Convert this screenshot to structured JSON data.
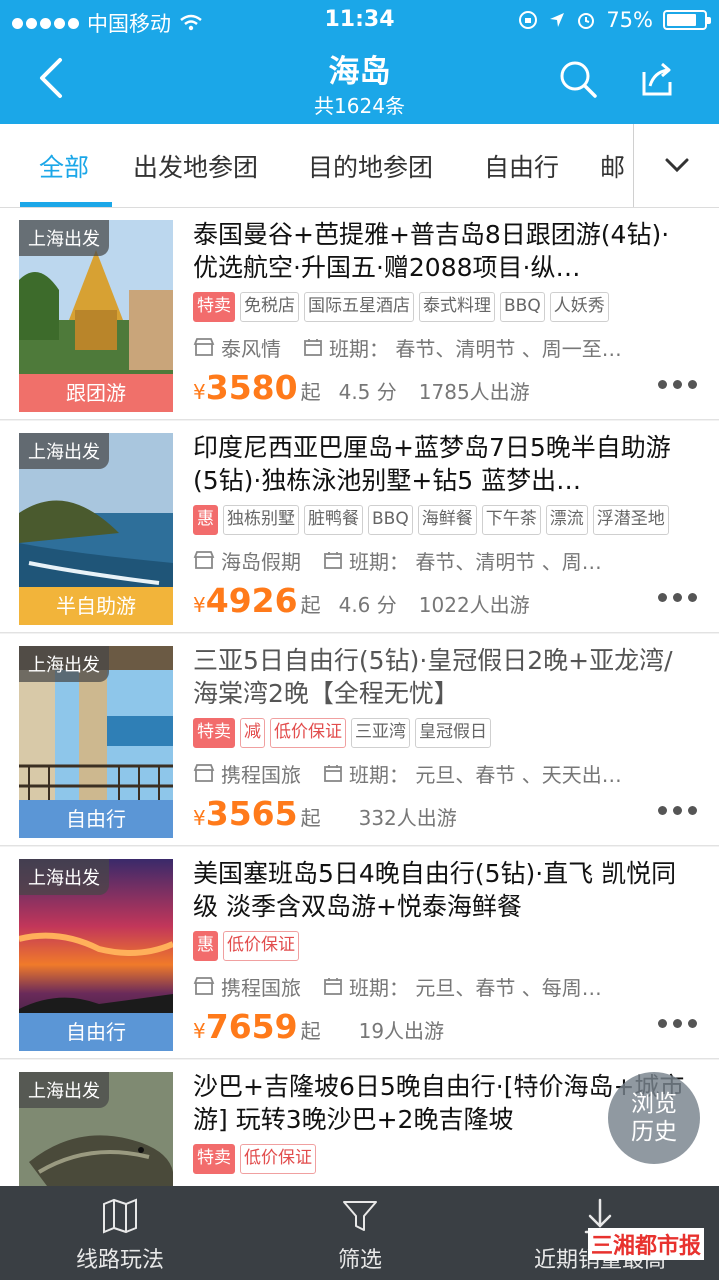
{
  "status_bar": {
    "carrier": "中国移动",
    "time": "11:34",
    "battery": "75%"
  },
  "header": {
    "title": "海岛",
    "subtitle": "共1624条"
  },
  "tabs": [
    {
      "label": "全部",
      "active": true
    },
    {
      "label": "出发地参团",
      "active": false
    },
    {
      "label": "目的地参团",
      "active": false
    },
    {
      "label": "自由行",
      "active": false
    },
    {
      "label": "邮",
      "active": false
    }
  ],
  "items": [
    {
      "depart": "上海出发",
      "type_label": "跟团游",
      "type_color": "#f0706a",
      "title": "泰国曼谷+芭提雅+普吉岛8日跟团游(4钻)·优选航空·升国五·赠2088项目·纵…",
      "tags": [
        {
          "text": "特卖",
          "style": "hot"
        },
        {
          "text": "免税店",
          "style": ""
        },
        {
          "text": "国际五星酒店",
          "style": ""
        },
        {
          "text": "泰式料理",
          "style": ""
        },
        {
          "text": "BBQ",
          "style": ""
        },
        {
          "text": "人妖秀",
          "style": ""
        }
      ],
      "supplier": "泰风情",
      "schedule": "班期：  春节、清明节  、周一至…",
      "price": "3580",
      "score": "4.5 分",
      "travelers": "1785人出游"
    },
    {
      "depart": "上海出发",
      "type_label": "半自助游",
      "type_color": "#f2b43a",
      "title": "印度尼西亚巴厘岛+蓝梦岛7日5晚半自助游(5钻)·独栋泳池别墅+钻5 蓝梦出…",
      "tags": [
        {
          "text": "惠",
          "style": "hot"
        },
        {
          "text": "独栋别墅",
          "style": ""
        },
        {
          "text": "脏鸭餐",
          "style": ""
        },
        {
          "text": "BBQ",
          "style": ""
        },
        {
          "text": "海鲜餐",
          "style": ""
        },
        {
          "text": "下午茶",
          "style": ""
        },
        {
          "text": "漂流",
          "style": ""
        },
        {
          "text": "浮潜圣地",
          "style": ""
        }
      ],
      "supplier": "海岛假期",
      "schedule": "班期：  春节、清明节  、周…",
      "price": "4926",
      "score": "4.6 分",
      "travelers": "1022人出游"
    },
    {
      "depart": "上海出发",
      "type_label": "自由行",
      "type_color": "#5b96d6",
      "title": "三亚5日自由行(5钻)·皇冠假日2晚+亚龙湾/海棠湾2晚【全程无忧】",
      "visited": true,
      "tags": [
        {
          "text": "特卖",
          "style": "hot"
        },
        {
          "text": "减",
          "style": "red"
        },
        {
          "text": "低价保证",
          "style": "red"
        },
        {
          "text": "三亚湾",
          "style": ""
        },
        {
          "text": "皇冠假日",
          "style": ""
        }
      ],
      "supplier": "携程国旅",
      "schedule": "班期：  元旦、春节  、天天出…",
      "price": "3565",
      "score": "",
      "travelers": "332人出游"
    },
    {
      "depart": "上海出发",
      "type_label": "自由行",
      "type_color": "#5b96d6",
      "title": "美国塞班岛5日4晚自由行(5钻)·直飞 凯悦同级 淡季含双岛游+悦泰海鲜餐",
      "tags": [
        {
          "text": "惠",
          "style": "hot"
        },
        {
          "text": "低价保证",
          "style": "red"
        }
      ],
      "supplier": "携程国旅",
      "schedule": "班期：  元旦、春节  、每周…",
      "price": "7659",
      "score": "",
      "travelers": "19人出游"
    },
    {
      "depart": "上海出发",
      "type_label": "",
      "type_color": "#5b96d6",
      "title": "沙巴+吉隆坡6日5晚自由行·[特价海岛+城市游] 玩转3晚沙巴+2晚吉隆坡",
      "tags": [
        {
          "text": "特卖",
          "style": "hot"
        },
        {
          "text": "低价保证",
          "style": "red"
        }
      ],
      "supplier": "",
      "schedule": "",
      "price": "",
      "score": "",
      "travelers": ""
    }
  ],
  "currency": "¥",
  "price_suffix": "起",
  "history_button": {
    "line1": "浏览",
    "line2": "历史"
  },
  "bottom_bar": [
    {
      "label": "线路玩法",
      "icon": "map-icon"
    },
    {
      "label": "筛选",
      "icon": "filter-icon"
    },
    {
      "label": "近期销量最高",
      "icon": "sort-down-icon"
    }
  ],
  "watermark": "三湘都市报"
}
